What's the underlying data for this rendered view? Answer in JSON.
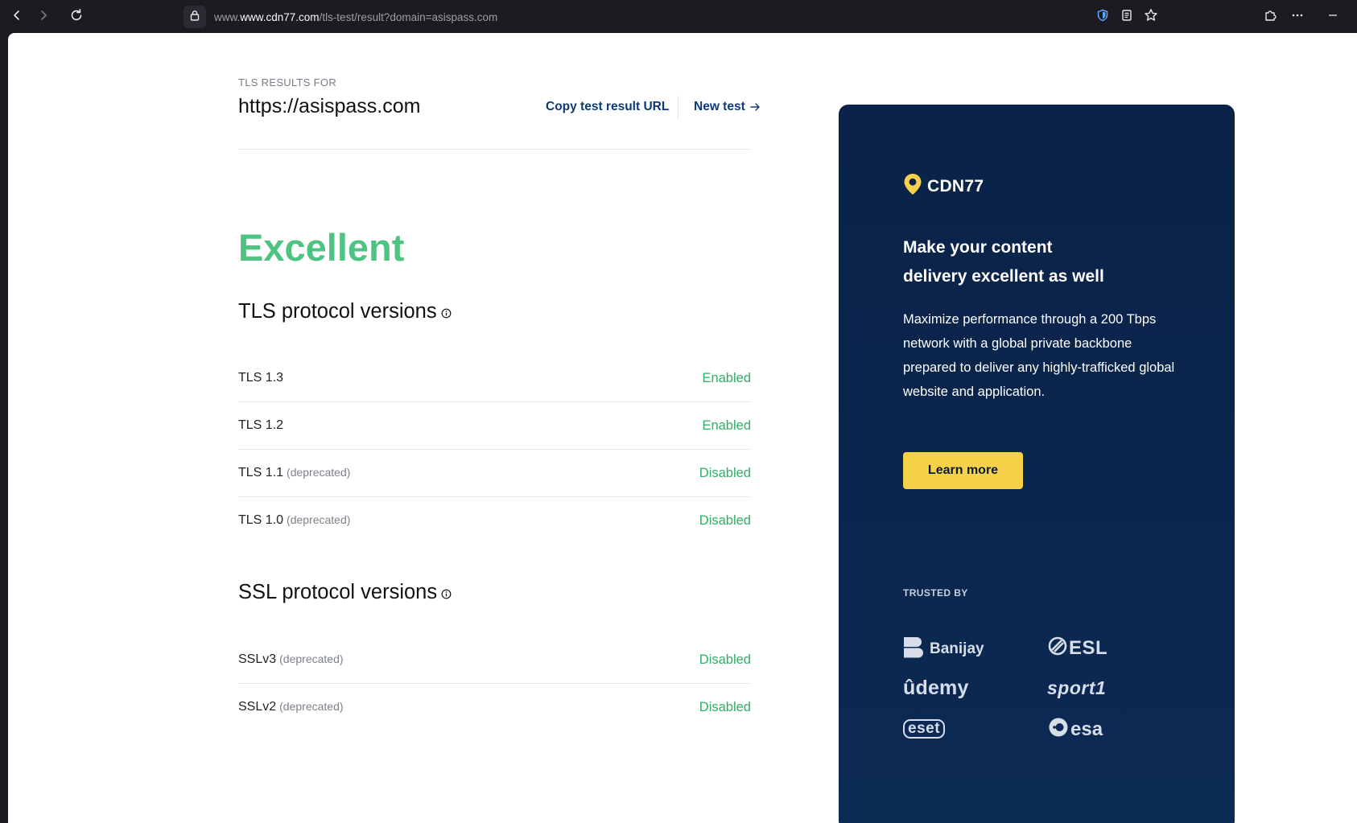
{
  "browser": {
    "url_domain": "www.cdn77.com",
    "url_path": "/tls-test/result?domain=asispass.com"
  },
  "header": {
    "results_label": "TLS RESULTS FOR",
    "domain": "https://asispass.com",
    "copy_link": "Copy test result URL",
    "new_test_link": "New test"
  },
  "grade": "Excellent",
  "tls_section": {
    "title": "TLS protocol versions",
    "rows": [
      {
        "label": "TLS 1.3",
        "note": "",
        "status": "Enabled"
      },
      {
        "label": "TLS 1.2",
        "note": "",
        "status": "Enabled"
      },
      {
        "label": "TLS 1.1",
        "note": "(deprecated)",
        "status": "Disabled"
      },
      {
        "label": "TLS 1.0",
        "note": "(deprecated)",
        "status": "Disabled"
      }
    ]
  },
  "ssl_section": {
    "title": "SSL protocol versions",
    "rows": [
      {
        "label": "SSLv3",
        "note": "(deprecated)",
        "status": "Disabled"
      },
      {
        "label": "SSLv2",
        "note": "(deprecated)",
        "status": "Disabled"
      }
    ]
  },
  "promo": {
    "brand": "CDN77",
    "headline_line1": "Make your content",
    "headline_line2": "delivery excellent as well",
    "body": "Maximize performance through a 200 Tbps network with a global private backbone prepared to deliver any highly-trafficked global website and application.",
    "button": "Learn more",
    "trusted_label": "TRUSTED BY",
    "logos": {
      "banijay": "Banijay",
      "esl": "ESL",
      "udemy": "ûdemy",
      "sport1": "sport1",
      "eset": "eset",
      "esa": "esa"
    }
  },
  "colors": {
    "grade_green": "#4dc481",
    "status_green": "#2fae64",
    "link_blue": "#0b3a75",
    "promo_bg": "#0a2247",
    "button_yellow": "#f5d24a",
    "brand_pin_yellow": "#f5d24a"
  }
}
